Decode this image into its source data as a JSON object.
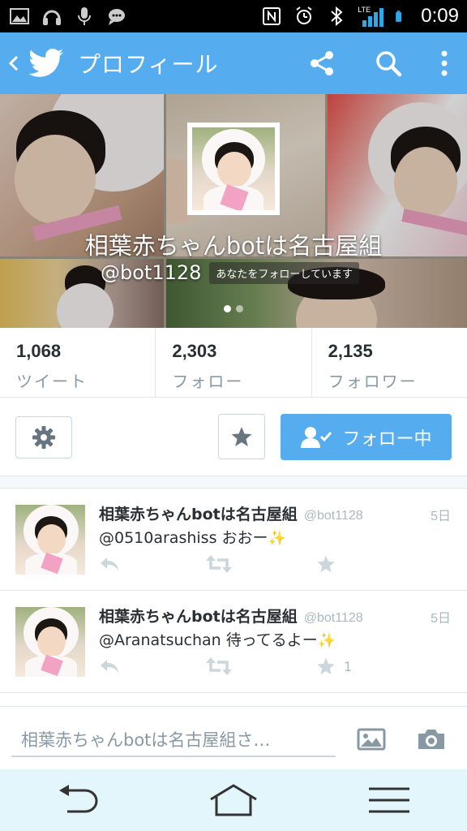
{
  "status_bar": {
    "time": "0:09",
    "icons": [
      "image-icon",
      "headphones-icon",
      "mic-icon",
      "chat-icon",
      "nfc-icon",
      "alarm-icon",
      "bluetooth-icon",
      "lte-signal-icon",
      "battery-icon"
    ],
    "network": "LTE"
  },
  "app_bar": {
    "title": "プロフィール",
    "back_icon": "chevron-left-icon",
    "logo_icon": "twitter-bird-icon",
    "actions": [
      "share-icon",
      "search-icon",
      "more-vert-icon"
    ]
  },
  "profile": {
    "name": "相葉赤ちゃんbotは名古屋組",
    "handle": "@bot1128",
    "follows_you": "あなたをフォローしています",
    "carousel_pages": 2,
    "carousel_active": 0
  },
  "stats": [
    {
      "value": "1,068",
      "label": "ツイート"
    },
    {
      "value": "2,303",
      "label": "フォロー"
    },
    {
      "value": "2,135",
      "label": "フォロワー"
    }
  ],
  "actions": {
    "settings_icon": "gear-icon",
    "favorite_icon": "star-icon",
    "follow_label": "フォロー中",
    "follow_icon": "user-check-icon"
  },
  "tweets": [
    {
      "name": "相葉赤ちゃんbotは名古屋組",
      "handle": "@bot1128",
      "time": "5日",
      "text": "@0510arashiss おおー",
      "emoji": "✨",
      "favorites": ""
    },
    {
      "name": "相葉赤ちゃんbotは名古屋組",
      "handle": "@bot1128",
      "time": "5日",
      "text": "@Aranatsuchan 待ってるよー",
      "emoji": "✨",
      "favorites": "1"
    }
  ],
  "compose": {
    "placeholder": "相葉赤ちゃんbotは名古屋組さ…",
    "image_icon": "image-icon",
    "camera_icon": "camera-icon"
  },
  "nav": [
    "back-icon",
    "home-icon",
    "menu-icon"
  ],
  "colors": {
    "accent": "#55acee",
    "text": "#292f33",
    "muted": "#8899a6",
    "border": "#e1e8ed",
    "navbar": "#e3f6fb"
  }
}
